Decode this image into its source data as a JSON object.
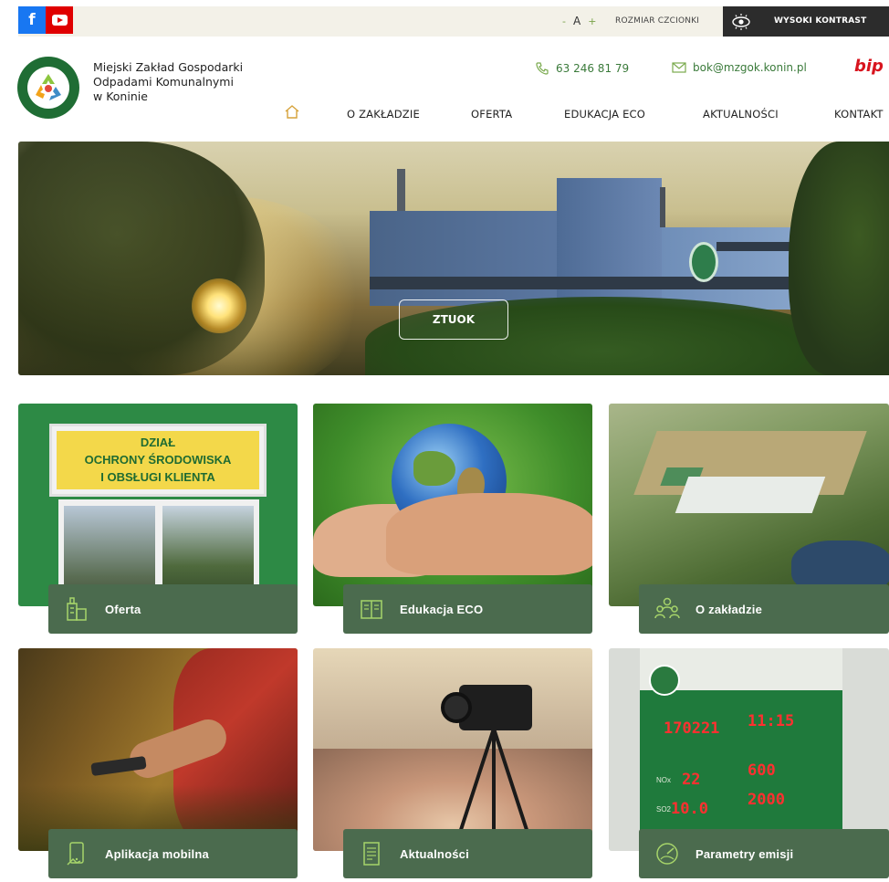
{
  "topbar": {
    "social": [
      {
        "name": "facebook",
        "icon": "facebook-icon"
      },
      {
        "name": "youtube",
        "icon": "youtube-icon"
      }
    ],
    "font_minus": "-",
    "font_a": "A",
    "font_plus": "+",
    "font_size_label": "ROZMIAR CZCIONKI",
    "contrast_label": "WYSOKI KONTRAST"
  },
  "header": {
    "org_name_line1": "Miejski Zakład Gospodarki",
    "org_name_line2": "Odpadami Komunalnymi",
    "org_name_line3": "w Koninie",
    "phone": "63 246 81 79",
    "email": "bok@mzgok.konin.pl",
    "bip": "bip"
  },
  "nav": {
    "items": [
      "O ZAKŁADZIE",
      "OFERTA",
      "EDUKACJA ECO",
      "AKTUALNOŚCI",
      "KONTAKT"
    ]
  },
  "hero": {
    "button_label": "ZTUOK"
  },
  "tiles": [
    {
      "label": "Oferta",
      "icon": "building-icon"
    },
    {
      "label": "Edukacja ECO",
      "icon": "book-icon"
    },
    {
      "label": "O zakładzie",
      "icon": "people-icon"
    },
    {
      "label": "Aplikacja mobilna",
      "icon": "mobile-icon"
    },
    {
      "label": "Aktualności",
      "icon": "document-icon"
    },
    {
      "label": "Parametry emisji",
      "icon": "gauge-icon"
    }
  ],
  "sign": {
    "line1": "DZIAŁ",
    "line2": "OCHRONY ŚRODOWISKA",
    "line3": "I OBSŁUGI KLIENTA"
  },
  "board": {
    "date": "170221",
    "time": "11:15",
    "nox_label": "NOx",
    "nox_val1": "22",
    "nox_val2": "600",
    "so2_label": "SO2",
    "so2_val1": "10.0",
    "so2_val2": "2000"
  },
  "colors": {
    "tile_label_bg": "#4b6b4e",
    "accent_green": "#3a7a3a",
    "bip_red": "#d8141e"
  }
}
